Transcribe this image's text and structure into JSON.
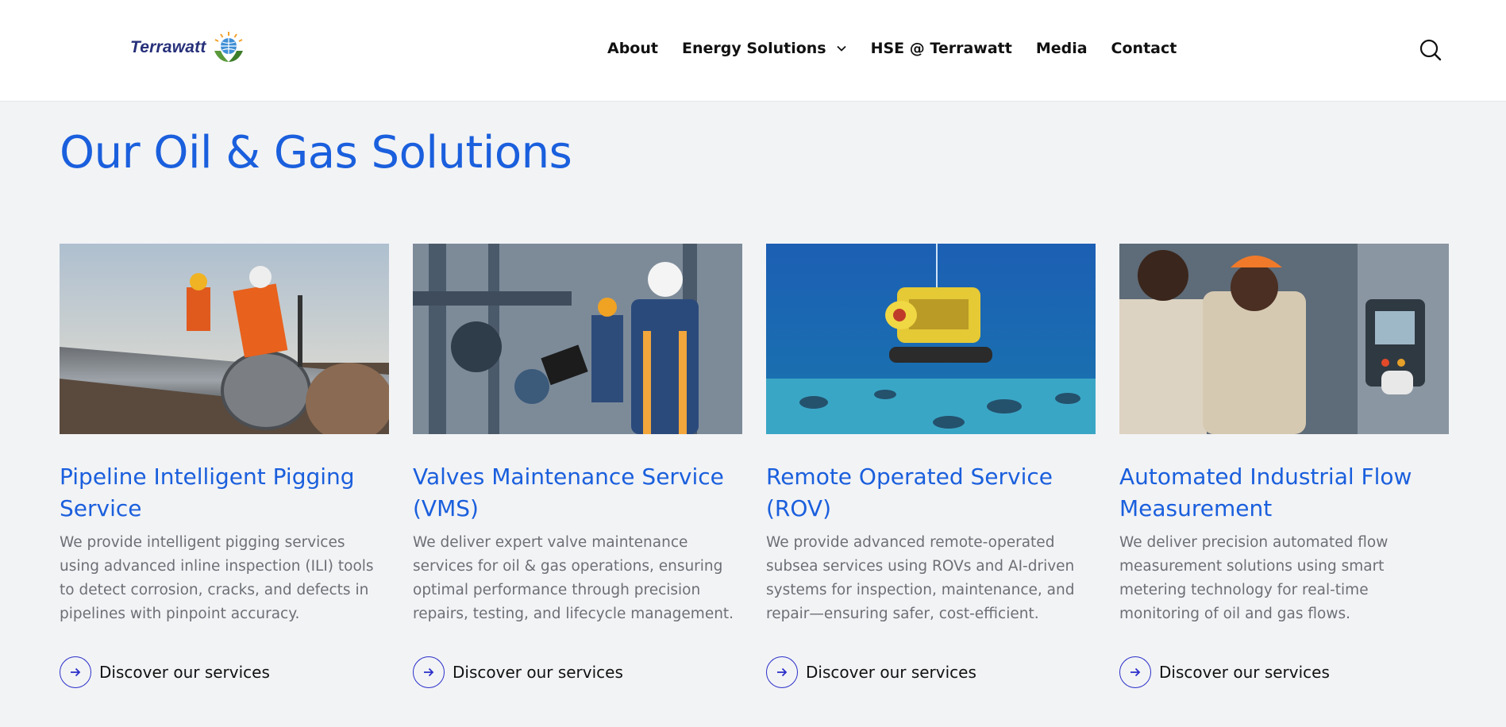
{
  "header": {
    "logo_text": "Terrawatt",
    "nav": [
      {
        "label": "About"
      },
      {
        "label": "Energy Solutions"
      },
      {
        "label": "HSE @ Terrawatt"
      },
      {
        "label": "Media"
      },
      {
        "label": "Contact"
      }
    ],
    "search_icon": "search-icon"
  },
  "main": {
    "title": "Our Oil & Gas Solutions",
    "cards": [
      {
        "title": "Pipeline Intelligent Pigging Service",
        "description": "We provide intelligent pigging services using advanced inline inspection (ILI) tools to detect corrosion, cracks, and defects in pipelines with pinpoint accuracy.",
        "link": "Discover our services",
        "image": "pipeline-inspection-photo"
      },
      {
        "title": "Valves Maintenance Service (VMS)",
        "description": "We deliver expert valve maintenance services for oil & gas operations, ensuring optimal performance through precision repairs, testing, and lifecycle management.",
        "link": "Discover our services",
        "image": "valve-technician-photo"
      },
      {
        "title": "Remote Operated Service (ROV)",
        "description": "We provide advanced remote-operated subsea services using ROVs and AI-driven systems for inspection, maintenance, and repair—ensuring safer, cost-efficient.",
        "link": "Discover our services",
        "image": "subsea-rov-photo"
      },
      {
        "title": "Automated Industrial Flow Measurement",
        "description": "We deliver precision automated flow measurement solutions using smart metering technology for real-time monitoring of oil and gas flows.",
        "link": "Discover our services",
        "image": "flow-measurement-photo"
      }
    ]
  },
  "colors": {
    "accent": "#1a5fdd",
    "logo_navy": "#27307a",
    "link_ring": "#2a2fc9",
    "background": "#f2f3f5"
  }
}
